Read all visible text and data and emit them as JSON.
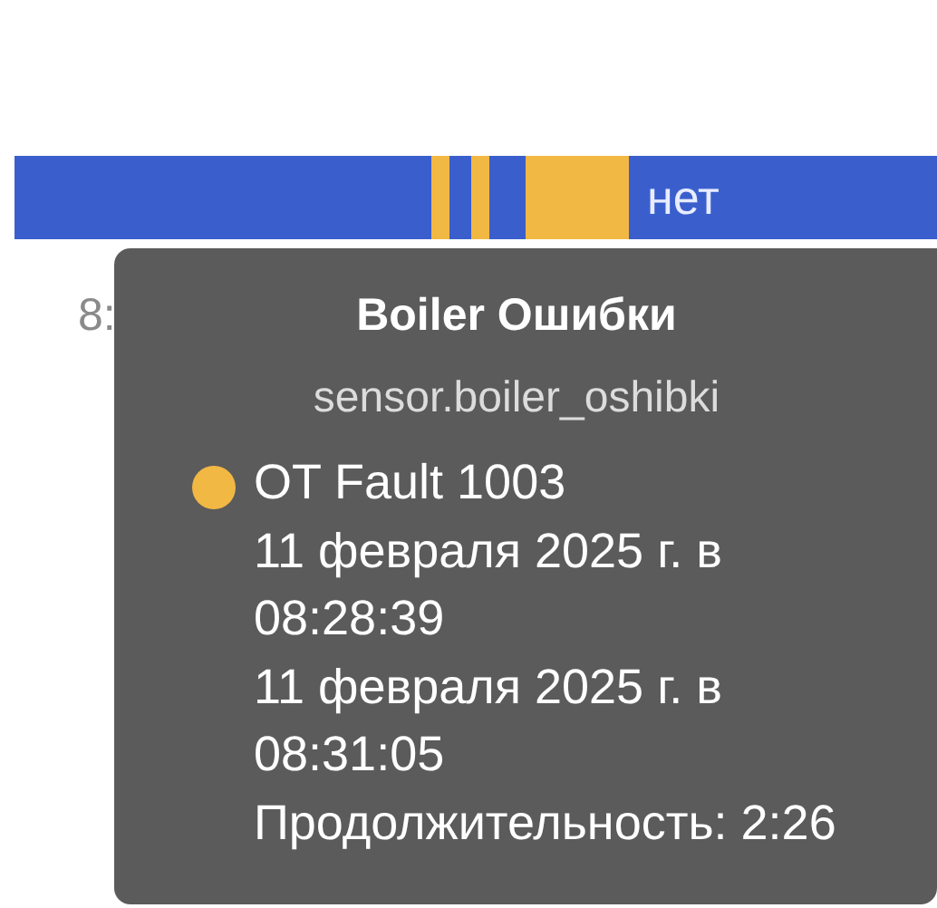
{
  "timeline": {
    "segments": [
      {
        "color": "#3a5fcd"
      },
      {
        "color": "#f2b844"
      },
      {
        "color": "#3a5fcd"
      },
      {
        "color": "#f2b844"
      },
      {
        "color": "#3a5fcd"
      },
      {
        "color": "#f2b844"
      },
      {
        "color": "#3a5fcd",
        "label": "нет"
      }
    ],
    "axis_labels": [
      "8:"
    ]
  },
  "tooltip": {
    "title": "Boiler Ошибки",
    "entity": "sensor.boiler_oshibki",
    "entries": [
      {
        "color": "#f2b844",
        "state": "OT Fault 1003",
        "start": "11 февраля 2025 г. в 08:28:39",
        "end": "11 февраля 2025 г. в 08:31:05",
        "duration": "Продолжительность: 2:26"
      }
    ]
  }
}
